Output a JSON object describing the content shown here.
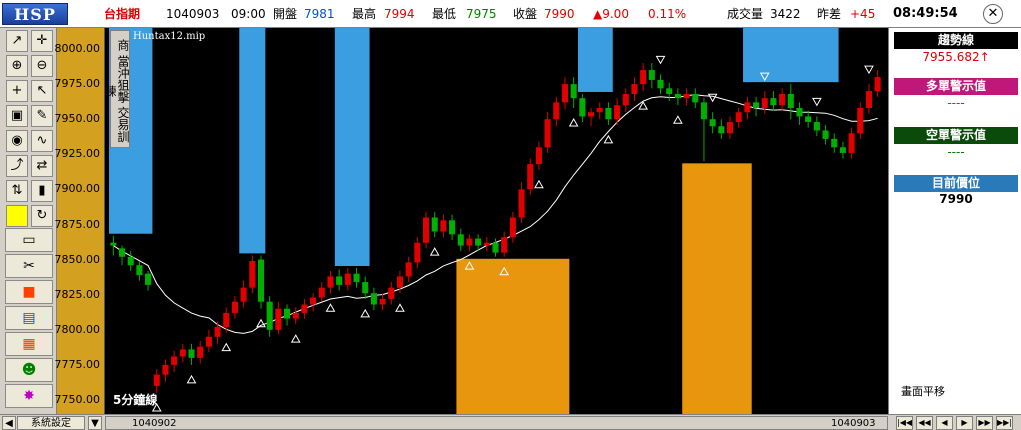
{
  "header": {
    "logo": "HSP",
    "symbol": "台指期",
    "date": "1040903",
    "time": "09:00",
    "open_label": "開盤",
    "open_value": "7981",
    "high_label": "最高",
    "high_value": "7994",
    "low_label": "最低",
    "low_value": "7975",
    "close_label": "收盤",
    "close_value": "7990",
    "change": "▲9.00",
    "change_pct": "0.11%",
    "volume_label": "成交量",
    "volume_value": "3422",
    "diff_label": "昨差",
    "diff_value": "+45",
    "clock": "08:49:54",
    "close_icon": "✕"
  },
  "toolbar": {
    "icons": [
      "line-draw-icon",
      "crosshair-icon",
      "zoom-in-icon",
      "zoom-out-icon",
      "add-icon",
      "cursor-icon",
      "lock-icon",
      "pencil-icon",
      "pattern-icon",
      "wave-icon",
      "trend-icon",
      "swap-icon",
      "up-down-icon",
      "candle-icon",
      "yellow-box-icon",
      "refresh-icon",
      "folder-icon",
      "scissors-icon",
      "stop-icon",
      "window-icon",
      "grid-icon",
      "people-icon",
      "fire-icon"
    ]
  },
  "chart": {
    "mode_label": "商 當沖狙擊 交易訓練",
    "file_label": "Huntax12.mip",
    "period_label": "5分鐘線",
    "colors": {
      "up": "#e00000",
      "down": "#00b000",
      "long_zone": "#e8960e",
      "short_zone": "#3a9ee0",
      "ma": "#ffffff",
      "bg": "#000000"
    }
  },
  "chart_data": {
    "type": "candlestick",
    "ylim": [
      7740,
      8015
    ],
    "y_ticks": [
      "8000.00",
      "7975.00",
      "7950.00",
      "7925.00",
      "7900.00",
      "7875.00",
      "7850.00",
      "7825.00",
      "7800.00",
      "7775.00",
      "7750.00"
    ],
    "x_labels": [
      "1040902",
      "1040903"
    ],
    "candles": [
      [
        7862,
        7860,
        7867,
        7853
      ],
      [
        7858,
        7852,
        7860,
        7846
      ],
      [
        7852,
        7846,
        7856,
        7842
      ],
      [
        7846,
        7839,
        7849,
        7835
      ],
      [
        7840,
        7832,
        7842,
        7828
      ],
      [
        7760,
        7768,
        7772,
        7755
      ],
      [
        7768,
        7775,
        7779,
        7763
      ],
      [
        7775,
        7781,
        7785,
        7770
      ],
      [
        7781,
        7786,
        7790,
        7777
      ],
      [
        7786,
        7780,
        7790,
        7775
      ],
      [
        7780,
        7788,
        7792,
        7776
      ],
      [
        7788,
        7795,
        7800,
        7784
      ],
      [
        7795,
        7802,
        7806,
        7790
      ],
      [
        7802,
        7812,
        7816,
        7798
      ],
      [
        7812,
        7820,
        7824,
        7808
      ],
      [
        7820,
        7830,
        7835,
        7816
      ],
      [
        7830,
        7849,
        7853,
        7826
      ],
      [
        7850,
        7820,
        7853,
        7815
      ],
      [
        7820,
        7800,
        7824,
        7795
      ],
      [
        7800,
        7815,
        7820,
        7797
      ],
      [
        7815,
        7808,
        7818,
        7803
      ],
      [
        7808,
        7812,
        7816,
        7804
      ],
      [
        7812,
        7818,
        7822,
        7808
      ],
      [
        7818,
        7823,
        7826,
        7813
      ],
      [
        7823,
        7830,
        7834,
        7820
      ],
      [
        7830,
        7838,
        7842,
        7826
      ],
      [
        7838,
        7832,
        7843,
        7828
      ],
      [
        7832,
        7840,
        7844,
        7828
      ],
      [
        7840,
        7834,
        7844,
        7830
      ],
      [
        7834,
        7826,
        7838,
        7822
      ],
      [
        7826,
        7818,
        7830,
        7814
      ],
      [
        7818,
        7822,
        7826,
        7814
      ],
      [
        7822,
        7830,
        7834,
        7818
      ],
      [
        7830,
        7838,
        7842,
        7826
      ],
      [
        7838,
        7848,
        7852,
        7834
      ],
      [
        7848,
        7862,
        7866,
        7844
      ],
      [
        7862,
        7880,
        7884,
        7858
      ],
      [
        7880,
        7870,
        7884,
        7866
      ],
      [
        7870,
        7878,
        7882,
        7866
      ],
      [
        7878,
        7868,
        7882,
        7864
      ],
      [
        7868,
        7860,
        7872,
        7856
      ],
      [
        7860,
        7865,
        7868,
        7856
      ],
      [
        7865,
        7860,
        7868,
        7856
      ],
      [
        7860,
        7862,
        7866,
        7856
      ],
      [
        7862,
        7855,
        7865,
        7852
      ],
      [
        7855,
        7866,
        7870,
        7852
      ],
      [
        7866,
        7880,
        7884,
        7862
      ],
      [
        7880,
        7900,
        7905,
        7876
      ],
      [
        7900,
        7918,
        7922,
        7896
      ],
      [
        7918,
        7930,
        7934,
        7914
      ],
      [
        7930,
        7950,
        7955,
        7926
      ],
      [
        7950,
        7962,
        7966,
        7945
      ],
      [
        7962,
        7975,
        7980,
        7957
      ],
      [
        7975,
        7965,
        7980,
        7958
      ],
      [
        7965,
        7952,
        7968,
        7948
      ],
      [
        7952,
        7955,
        7958,
        7945
      ],
      [
        7955,
        7958,
        7962,
        7950
      ],
      [
        7958,
        7950,
        7962,
        7946
      ],
      [
        7950,
        7960,
        7965,
        7946
      ],
      [
        7960,
        7968,
        7972,
        7955
      ],
      [
        7968,
        7975,
        7980,
        7963
      ],
      [
        7975,
        7985,
        7990,
        7970
      ],
      [
        7985,
        7978,
        7990,
        7972
      ],
      [
        7978,
        7972,
        7982,
        7968
      ],
      [
        7972,
        7968,
        7976,
        7963
      ],
      [
        7968,
        7965,
        7972,
        7960
      ],
      [
        7965,
        7968,
        7972,
        7960
      ],
      [
        7968,
        7962,
        7972,
        7958
      ],
      [
        7962,
        7950,
        7965,
        7920
      ],
      [
        7950,
        7945,
        7955,
        7940
      ],
      [
        7945,
        7940,
        7950,
        7936
      ],
      [
        7940,
        7948,
        7952,
        7936
      ],
      [
        7948,
        7955,
        7958,
        7944
      ],
      [
        7955,
        7962,
        7966,
        7950
      ],
      [
        7962,
        7958,
        7966,
        7952
      ],
      [
        7958,
        7965,
        7970,
        7954
      ],
      [
        7965,
        7960,
        7970,
        7956
      ],
      [
        7960,
        7968,
        7972,
        7956
      ],
      [
        7968,
        7958,
        7975,
        7950
      ],
      [
        7958,
        7952,
        7962,
        7946
      ],
      [
        7952,
        7948,
        7956,
        7944
      ],
      [
        7948,
        7942,
        7952,
        7938
      ],
      [
        7942,
        7936,
        7946,
        7932
      ],
      [
        7936,
        7930,
        7940,
        7926
      ],
      [
        7930,
        7926,
        7934,
        7922
      ],
      [
        7926,
        7940,
        7944,
        7922
      ],
      [
        7940,
        7958,
        7962,
        7936
      ],
      [
        7958,
        7970,
        7975,
        7954
      ],
      [
        7970,
        7980,
        7985,
        7966
      ]
    ],
    "zones": [
      {
        "type": "short",
        "from": 0,
        "to": 4
      },
      {
        "type": "short",
        "from": 15,
        "to": 17
      },
      {
        "type": "short",
        "from": 26,
        "to": 29
      },
      {
        "type": "long",
        "from": 40,
        "to": 52
      },
      {
        "type": "short",
        "from": 54,
        "to": 57
      },
      {
        "type": "long",
        "from": 66,
        "to": 73
      },
      {
        "type": "short",
        "from": 73,
        "to": 83
      }
    ]
  },
  "panel": {
    "trend_title": "趨勢線",
    "trend_value": "7955.682↑",
    "long_title": "多單警示值",
    "long_value": "----",
    "short_title": "空單警示值",
    "short_value": "----",
    "position_title": "目前價位",
    "position_value": "7990",
    "footer": "畫面平移"
  },
  "bottom": {
    "settings_label": "系統設定",
    "date_left": "1040902",
    "date_right": "1040903",
    "nav": [
      "|◀◀",
      "◀◀",
      "◀",
      "▶",
      "▶▶",
      "▶▶|"
    ]
  }
}
